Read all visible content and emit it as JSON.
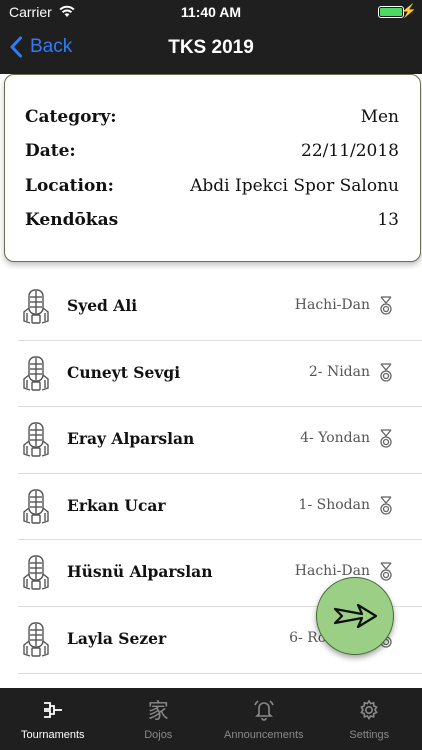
{
  "status_bar": {
    "carrier": "Carrier",
    "time": "11:40 AM"
  },
  "nav": {
    "back_label": "Back",
    "title": "TKS 2019"
  },
  "info": {
    "category_label": "Category:",
    "category_value": "Men",
    "date_label": "Date:",
    "date_value": "22/11/2018",
    "location_label": "Location:",
    "location_value": "Abdi Ipekci Spor Salonu",
    "kendokas_label": "Kendōkas",
    "kendokas_value": "13"
  },
  "participants": [
    {
      "name": "Syed Ali",
      "rank": "Hachi-Dan"
    },
    {
      "name": "Cuneyt Sevgi",
      "rank": "2- Nidan"
    },
    {
      "name": "Eray Alparslan",
      "rank": "4- Yondan"
    },
    {
      "name": "Erkan Ucar",
      "rank": "1- Shodan"
    },
    {
      "name": "Hüsnü Alparslan",
      "rank": "Hachi-Dan"
    },
    {
      "name": "Layla Sezer",
      "rank": "6- Rokudan"
    }
  ],
  "tabs": [
    {
      "label": "Tournaments",
      "icon": "bracket-icon",
      "active": true
    },
    {
      "label": "Dojos",
      "icon": "dojo-kanji-icon",
      "glyph": "家",
      "active": false
    },
    {
      "label": "Announcements",
      "icon": "bell-icon",
      "active": false
    },
    {
      "label": "Settings",
      "icon": "gear-icon",
      "active": false
    }
  ],
  "colors": {
    "bar_bg": "#1f1f1f",
    "back_blue": "#2f7cf6",
    "fab_green": "#9ccf86",
    "battery_green": "#4cd964"
  }
}
